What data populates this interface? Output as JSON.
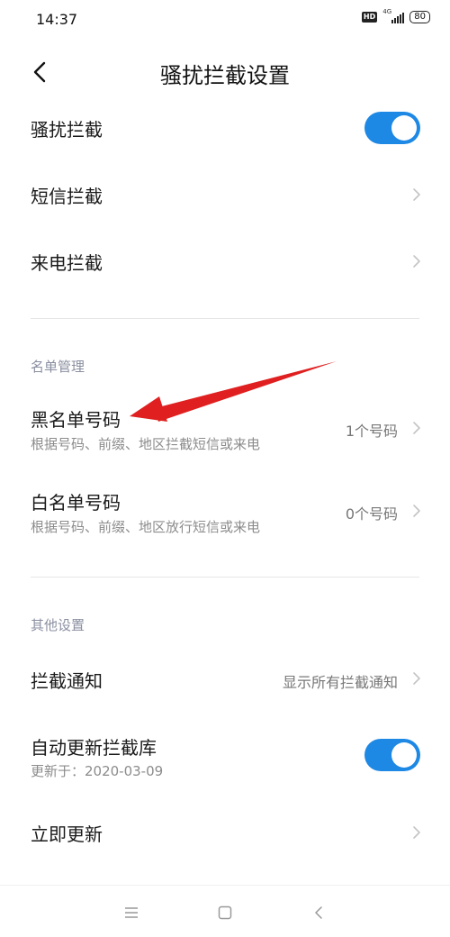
{
  "status_bar": {
    "time": "14:37",
    "hd": "HD",
    "network": "4G",
    "battery": "80"
  },
  "header": {
    "title": "骚扰拦截设置"
  },
  "harassment_block": {
    "label": "骚扰拦截",
    "enabled": true
  },
  "sms_block": {
    "label": "短信拦截"
  },
  "call_block": {
    "label": "来电拦截"
  },
  "list_section": {
    "heading": "名单管理",
    "blacklist": {
      "label": "黑名单号码",
      "sub": "根据号码、前缀、地区拦截短信或来电",
      "value": "1个号码"
    },
    "whitelist": {
      "label": "白名单号码",
      "sub": "根据号码、前缀、地区放行短信或来电",
      "value": "0个号码"
    }
  },
  "other_section": {
    "heading": "其他设置",
    "notify": {
      "label": "拦截通知",
      "value": "显示所有拦截通知"
    },
    "auto_update": {
      "label": "自动更新拦截库",
      "sub": "更新于：2020-03-09",
      "enabled": true
    },
    "update_now": {
      "label": "立即更新"
    }
  },
  "colors": {
    "accent": "#1e88e5",
    "annotation_arrow": "#e02020"
  },
  "icons": [
    "back-arrow-icon",
    "chevron-right-icon",
    "menu-icon",
    "home-icon",
    "back-icon"
  ]
}
